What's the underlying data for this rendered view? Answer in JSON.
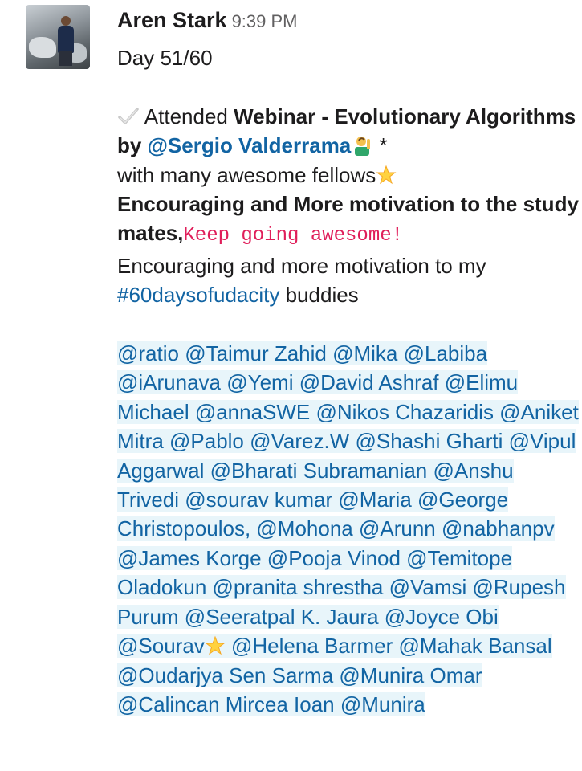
{
  "message": {
    "sender": "Aren Stark",
    "time": "9:39 PM",
    "day": "Day 51/60",
    "line1_prefix": "Attended ",
    "webinar": "Webinar - Evolutionary Algorithms by ",
    "speaker_mention": "@Sergio Valderrama",
    "after_speaker": " *",
    "fellows": "with many awesome fellows",
    "encouraging_bold": "Encouraging and More motivation to the study mates,",
    "keep_going": "Keep going awesome!",
    "encouraging_plain": "Encouraging and more motivation to my ",
    "hashtag": "#60daysofudacity",
    "buddies": " buddies",
    "mentions_text": "@ratio  @Taimur Zahid @Mika @Labiba @iArunava @Yemi @David Ashraf @Elimu Michael @annaSWE @Nikos Chazaridis @Aniket Mitra @Pablo  @Varez.W @Shashi Gharti  @Vipul Ag­garwal  @Bharati Subramanian  @Anshu Trivedi  @sourav kumar  @Maria  @George Christopoulos,  @Mohona @Arunn @nabhanpv @James Korge  @Pooja Vinod @Temitope Oladokun @pranita shrestha @Vamsi @Rupesh Purum @Seeratpal K. Jaura @Joyce Obi @Sourav",
    "mentions_tail": " @Helena Barmer @Mahak Bansal @Oudarjya Sen Sarma @Munira Omar @Calincan Mircea Ioan @Munira"
  },
  "icons": {
    "check": "check-mark-icon",
    "star": "glowing-star-icon",
    "person": "person-raising-hand-icon"
  },
  "colors": {
    "link": "#1264a3",
    "code": "#e01e5a",
    "mention_bg": "#e8f5fa",
    "text": "#1d1c1d"
  }
}
